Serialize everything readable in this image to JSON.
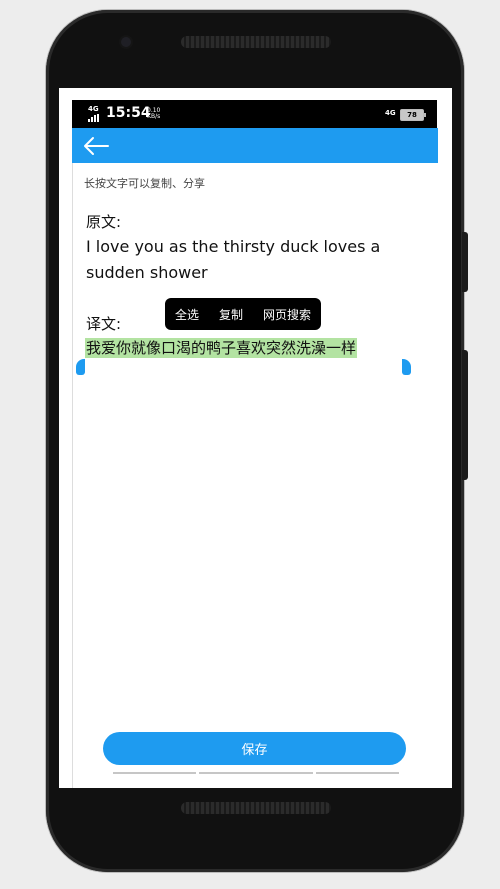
{
  "status_bar": {
    "network_type": "4G",
    "time": "15:54",
    "speed_value": "0.10",
    "speed_unit": "KB/s",
    "network_type_right": "4G",
    "battery": "78"
  },
  "app_bar": {
    "back_icon": "arrow-left-icon"
  },
  "hint": "长按文字可以复制、分享",
  "original": {
    "label": "原文:",
    "text": "I love you as the thirsty duck loves a sudden shower"
  },
  "translation": {
    "label": "译文:",
    "text": "我爱你就像口渴的鸭子喜欢突然洗澡一样"
  },
  "context_menu": {
    "select_all": "全选",
    "copy": "复制",
    "web_search": "网页搜索"
  },
  "save_button": "保存",
  "colors": {
    "accent": "#1e9bf0",
    "selection": "#b3e3a2",
    "status_bar": "#000000"
  }
}
